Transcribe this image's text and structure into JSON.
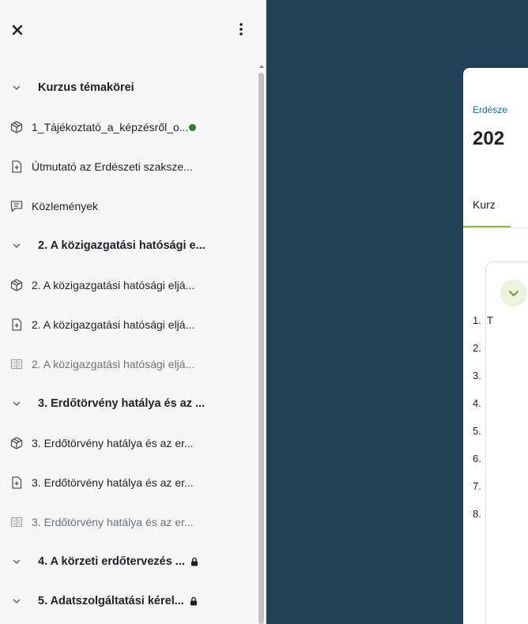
{
  "sidebar": {
    "items": [
      {
        "type": "section",
        "label": "Kurzus témakörei",
        "locked": false
      },
      {
        "type": "activity",
        "icon": "package-icon",
        "label": "1_Tájékoztató_a_képzésről_o...",
        "dot": true,
        "dim": false
      },
      {
        "type": "activity",
        "icon": "file-icon",
        "label": "Útmutató az Erdészeti szaksze...",
        "dot": false,
        "dim": false
      },
      {
        "type": "activity",
        "icon": "forum-icon",
        "label": "Közlemények",
        "dot": false,
        "dim": false
      },
      {
        "type": "section",
        "label": "2. A közigazgatási hatósági e...",
        "locked": false
      },
      {
        "type": "activity",
        "icon": "package-icon",
        "label": "2. A közigazgatási hatósági eljá...",
        "dot": false,
        "dim": false
      },
      {
        "type": "activity",
        "icon": "file-icon",
        "label": "2. A közigazgatási hatósági eljá...",
        "dot": false,
        "dim": false
      },
      {
        "type": "activity",
        "icon": "book-icon",
        "label": "2. A közigazgatási hatósági eljá...",
        "dot": false,
        "dim": true
      },
      {
        "type": "section",
        "label": "3. Erdőtörvény hatálya és az ...",
        "locked": false
      },
      {
        "type": "activity",
        "icon": "package-icon",
        "label": "3. Erdőtörvény hatálya és az er...",
        "dot": false,
        "dim": false
      },
      {
        "type": "activity",
        "icon": "file-icon",
        "label": "3. Erdőtörvény hatálya és az er...",
        "dot": false,
        "dim": false
      },
      {
        "type": "activity",
        "icon": "book-icon",
        "label": "3. Erdőtörvény hatálya és az er...",
        "dot": false,
        "dim": true
      },
      {
        "type": "section",
        "label": "4. A körzeti erdőtervezés ...",
        "locked": true
      },
      {
        "type": "section",
        "label": "5. Adatszolgáltatási kérel...",
        "locked": true
      }
    ]
  },
  "main": {
    "breadcrumb": "Erdésze",
    "course_title": "202",
    "tab_label": "Kurz",
    "list_numbers": [
      "1.",
      "2.",
      "3.",
      "4.",
      "5.",
      "6.",
      "7.",
      "8."
    ],
    "list_first_char": "T"
  },
  "colors": {
    "main_bg": "#204156",
    "accent_green": "#8bbf42",
    "status_dot": "#357a32",
    "link": "#0f6cbf"
  }
}
